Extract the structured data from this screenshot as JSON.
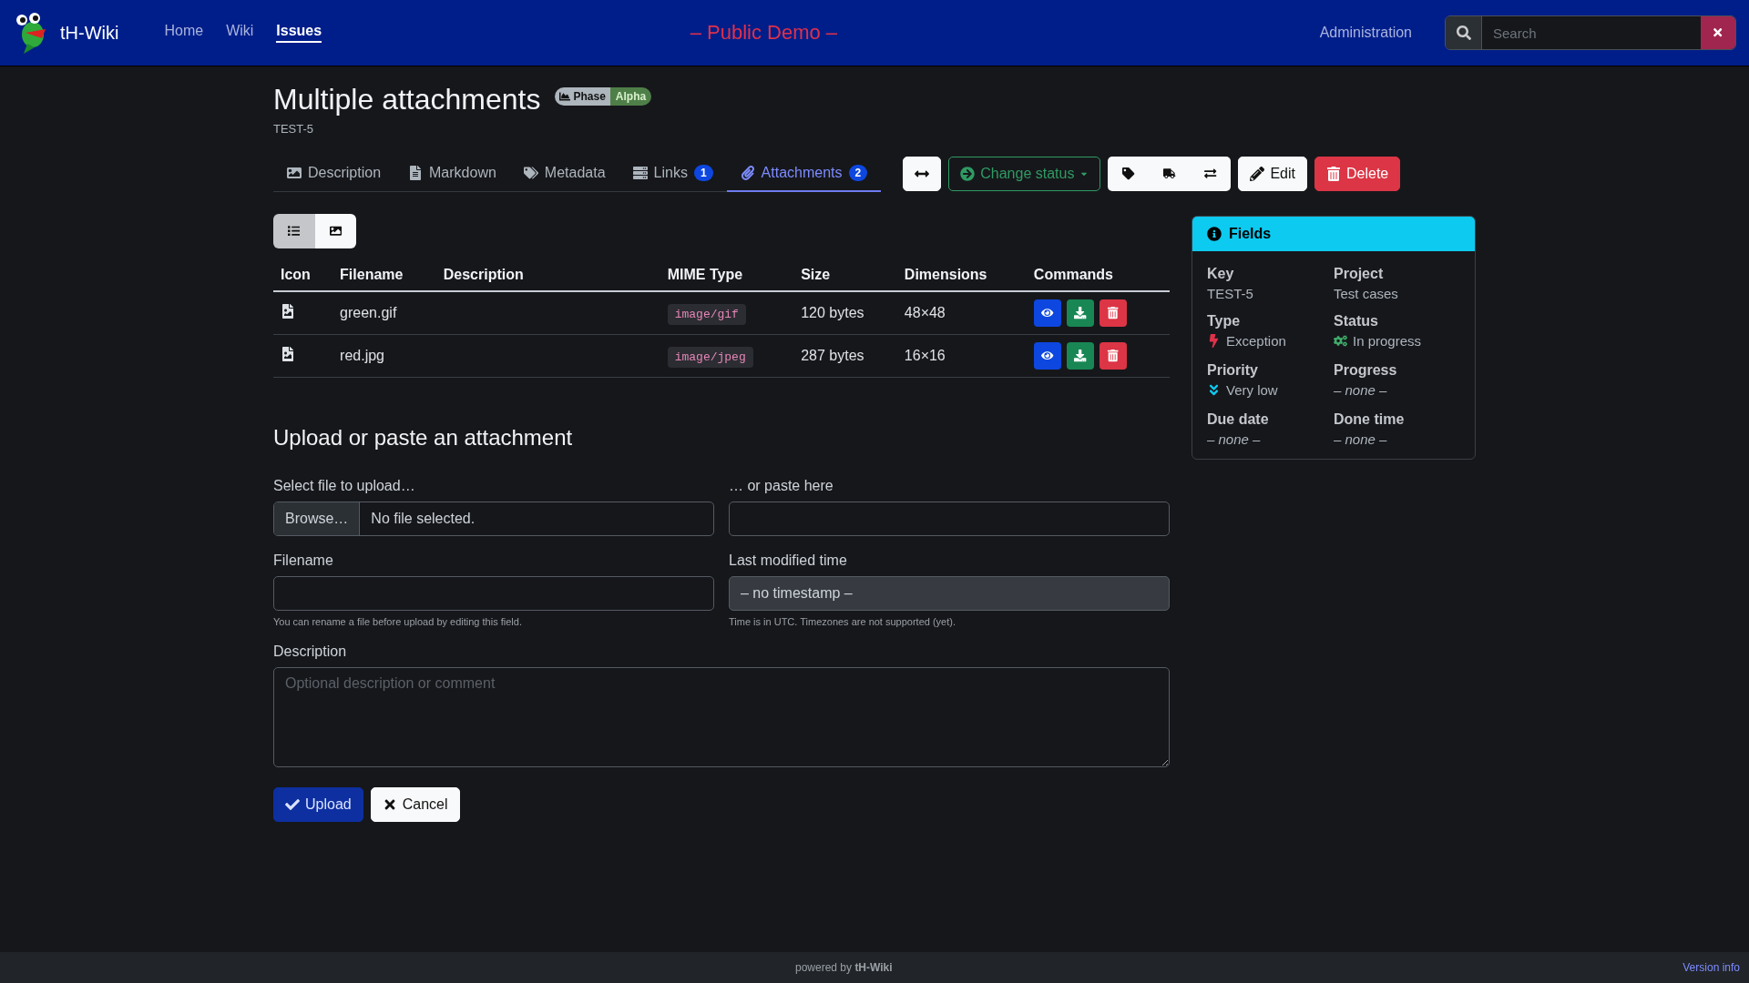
{
  "navbar": {
    "brand": "tH-Wiki",
    "links": [
      {
        "label": "Home",
        "selected": false
      },
      {
        "label": "Wiki",
        "selected": false
      },
      {
        "label": "Issues",
        "selected": true
      }
    ],
    "banner": "– Public Demo –",
    "admin": "Administration",
    "search": {
      "placeholder": "Search"
    }
  },
  "issue": {
    "title": "Multiple attachments",
    "badge": {
      "label": "Phase",
      "value": "Alpha"
    },
    "key": "TEST-5"
  },
  "tabs": [
    {
      "label": "Description",
      "selected": false
    },
    {
      "label": "Markdown",
      "selected": false
    },
    {
      "label": "Metadata",
      "selected": false
    },
    {
      "label": "Links",
      "count": "1",
      "selected": false
    },
    {
      "label": "Attachments",
      "count": "2",
      "selected": true
    }
  ],
  "toolbar": {
    "change_status": "Change status",
    "edit": "Edit",
    "delete": "Delete"
  },
  "view_toggle": [
    {
      "kind": "list",
      "selected": true
    },
    {
      "kind": "gallery",
      "selected": false
    }
  ],
  "table": {
    "columns": [
      "Icon",
      "Filename",
      "Description",
      "MIME Type",
      "Size",
      "Dimensions",
      "Commands"
    ],
    "rows": [
      {
        "filename": "green.gif",
        "mime": "image/gif",
        "size": "120 bytes",
        "dimensions": "48×48"
      },
      {
        "filename": "red.jpg",
        "mime": "image/jpeg",
        "size": "287 bytes",
        "dimensions": "16×16"
      }
    ]
  },
  "upload": {
    "heading": "Upload or paste an attachment",
    "file_label": "Select file to upload…",
    "browse": "Browse…",
    "no_file": "No file selected.",
    "paste_label": "… or paste here",
    "filename_label": "Filename",
    "filename_help": "You can rename a file before upload by editing this field.",
    "modified_label": "Last modified time",
    "modified_value": "– no timestamp –",
    "modified_help": "Time is in UTC. Timezones are not supported (yet).",
    "description_label": "Description",
    "description_placeholder": "Optional description or comment",
    "upload": "Upload",
    "cancel": "Cancel"
  },
  "fields": {
    "title": "Fields",
    "items": [
      {
        "label": "Key",
        "value": "TEST-5",
        "kind": "plain"
      },
      {
        "label": "Project",
        "value": "Test cases",
        "kind": "plain"
      },
      {
        "label": "Type",
        "value": "Exception",
        "kind": "type"
      },
      {
        "label": "Status",
        "value": "In progress",
        "kind": "status"
      },
      {
        "label": "Priority",
        "value": "Very low",
        "kind": "priority"
      },
      {
        "label": "Progress",
        "value": "– none –",
        "kind": "empty"
      },
      {
        "label": "Due date",
        "value": "– none –",
        "kind": "empty"
      },
      {
        "label": "Done time",
        "value": "– none –",
        "kind": "empty"
      }
    ]
  },
  "footer": {
    "powered": "powered by",
    "brand": "tH-Wiki",
    "version": "Version info"
  }
}
